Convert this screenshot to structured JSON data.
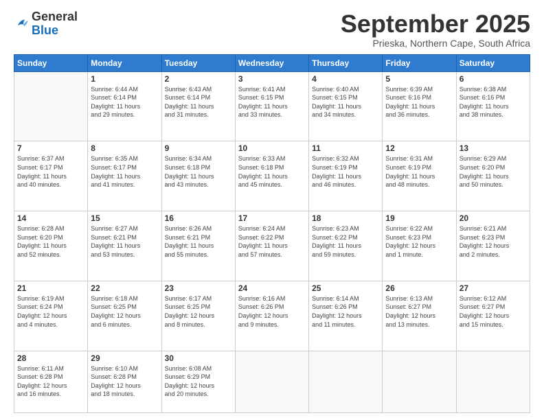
{
  "header": {
    "logo_general": "General",
    "logo_blue": "Blue",
    "month_title": "September 2025",
    "subtitle": "Prieska, Northern Cape, South Africa"
  },
  "weekdays": [
    "Sunday",
    "Monday",
    "Tuesday",
    "Wednesday",
    "Thursday",
    "Friday",
    "Saturday"
  ],
  "weeks": [
    [
      {
        "day": "",
        "info": ""
      },
      {
        "day": "1",
        "info": "Sunrise: 6:44 AM\nSunset: 6:14 PM\nDaylight: 11 hours\nand 29 minutes."
      },
      {
        "day": "2",
        "info": "Sunrise: 6:43 AM\nSunset: 6:14 PM\nDaylight: 11 hours\nand 31 minutes."
      },
      {
        "day": "3",
        "info": "Sunrise: 6:41 AM\nSunset: 6:15 PM\nDaylight: 11 hours\nand 33 minutes."
      },
      {
        "day": "4",
        "info": "Sunrise: 6:40 AM\nSunset: 6:15 PM\nDaylight: 11 hours\nand 34 minutes."
      },
      {
        "day": "5",
        "info": "Sunrise: 6:39 AM\nSunset: 6:16 PM\nDaylight: 11 hours\nand 36 minutes."
      },
      {
        "day": "6",
        "info": "Sunrise: 6:38 AM\nSunset: 6:16 PM\nDaylight: 11 hours\nand 38 minutes."
      }
    ],
    [
      {
        "day": "7",
        "info": "Sunrise: 6:37 AM\nSunset: 6:17 PM\nDaylight: 11 hours\nand 40 minutes."
      },
      {
        "day": "8",
        "info": "Sunrise: 6:35 AM\nSunset: 6:17 PM\nDaylight: 11 hours\nand 41 minutes."
      },
      {
        "day": "9",
        "info": "Sunrise: 6:34 AM\nSunset: 6:18 PM\nDaylight: 11 hours\nand 43 minutes."
      },
      {
        "day": "10",
        "info": "Sunrise: 6:33 AM\nSunset: 6:18 PM\nDaylight: 11 hours\nand 45 minutes."
      },
      {
        "day": "11",
        "info": "Sunrise: 6:32 AM\nSunset: 6:19 PM\nDaylight: 11 hours\nand 46 minutes."
      },
      {
        "day": "12",
        "info": "Sunrise: 6:31 AM\nSunset: 6:19 PM\nDaylight: 11 hours\nand 48 minutes."
      },
      {
        "day": "13",
        "info": "Sunrise: 6:29 AM\nSunset: 6:20 PM\nDaylight: 11 hours\nand 50 minutes."
      }
    ],
    [
      {
        "day": "14",
        "info": "Sunrise: 6:28 AM\nSunset: 6:20 PM\nDaylight: 11 hours\nand 52 minutes."
      },
      {
        "day": "15",
        "info": "Sunrise: 6:27 AM\nSunset: 6:21 PM\nDaylight: 11 hours\nand 53 minutes."
      },
      {
        "day": "16",
        "info": "Sunrise: 6:26 AM\nSunset: 6:21 PM\nDaylight: 11 hours\nand 55 minutes."
      },
      {
        "day": "17",
        "info": "Sunrise: 6:24 AM\nSunset: 6:22 PM\nDaylight: 11 hours\nand 57 minutes."
      },
      {
        "day": "18",
        "info": "Sunrise: 6:23 AM\nSunset: 6:22 PM\nDaylight: 11 hours\nand 59 minutes."
      },
      {
        "day": "19",
        "info": "Sunrise: 6:22 AM\nSunset: 6:23 PM\nDaylight: 12 hours\nand 1 minute."
      },
      {
        "day": "20",
        "info": "Sunrise: 6:21 AM\nSunset: 6:23 PM\nDaylight: 12 hours\nand 2 minutes."
      }
    ],
    [
      {
        "day": "21",
        "info": "Sunrise: 6:19 AM\nSunset: 6:24 PM\nDaylight: 12 hours\nand 4 minutes."
      },
      {
        "day": "22",
        "info": "Sunrise: 6:18 AM\nSunset: 6:25 PM\nDaylight: 12 hours\nand 6 minutes."
      },
      {
        "day": "23",
        "info": "Sunrise: 6:17 AM\nSunset: 6:25 PM\nDaylight: 12 hours\nand 8 minutes."
      },
      {
        "day": "24",
        "info": "Sunrise: 6:16 AM\nSunset: 6:26 PM\nDaylight: 12 hours\nand 9 minutes."
      },
      {
        "day": "25",
        "info": "Sunrise: 6:14 AM\nSunset: 6:26 PM\nDaylight: 12 hours\nand 11 minutes."
      },
      {
        "day": "26",
        "info": "Sunrise: 6:13 AM\nSunset: 6:27 PM\nDaylight: 12 hours\nand 13 minutes."
      },
      {
        "day": "27",
        "info": "Sunrise: 6:12 AM\nSunset: 6:27 PM\nDaylight: 12 hours\nand 15 minutes."
      }
    ],
    [
      {
        "day": "28",
        "info": "Sunrise: 6:11 AM\nSunset: 6:28 PM\nDaylight: 12 hours\nand 16 minutes."
      },
      {
        "day": "29",
        "info": "Sunrise: 6:10 AM\nSunset: 6:28 PM\nDaylight: 12 hours\nand 18 minutes."
      },
      {
        "day": "30",
        "info": "Sunrise: 6:08 AM\nSunset: 6:29 PM\nDaylight: 12 hours\nand 20 minutes."
      },
      {
        "day": "",
        "info": ""
      },
      {
        "day": "",
        "info": ""
      },
      {
        "day": "",
        "info": ""
      },
      {
        "day": "",
        "info": ""
      }
    ]
  ]
}
